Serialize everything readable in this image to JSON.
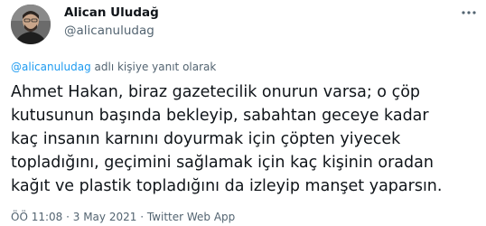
{
  "author": {
    "name": "Alican Uludağ",
    "handle": "@alicanuludag",
    "more_icon": "more-dots-icon"
  },
  "reply_context": {
    "mention": "@alicanuludag",
    "text": " adlı kişiye yanıt olarak"
  },
  "tweet": {
    "lines": [
      "Ahmet Hakan, biraz gazetecilik onurun varsa; o çöp",
      "kutusunun başında bekleyip, sabahtan geceye kadar",
      "kaç insanın karnını doyurmak için çöpten yiyecek",
      "topladığını, geçimini sağlamak için kaç kişinin oradan",
      "kağıt ve plastik topladığını da izleyip manşet yaparsın."
    ]
  },
  "meta": {
    "time": "ÖÖ 11:08",
    "separator1": " · ",
    "date": "3 May 2021",
    "separator2": " · ",
    "source": "Twitter Web App"
  },
  "colors": {
    "accent": "#1d9bf0",
    "text": "#0f1419",
    "secondary": "#536471"
  }
}
